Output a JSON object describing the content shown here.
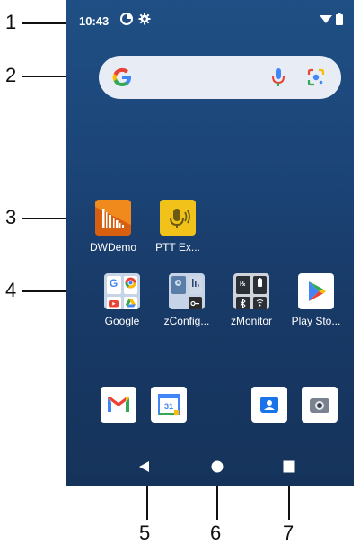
{
  "callouts": [
    "1",
    "2",
    "3",
    "4",
    "5",
    "6",
    "7"
  ],
  "status_bar": {
    "time": "10:43",
    "icons": [
      "data-saver-icon",
      "settings-gear-icon",
      "wifi-icon",
      "battery-icon"
    ]
  },
  "search": {
    "logo_icon": "google-g-icon",
    "mic_icon": "microphone-icon",
    "lens_icon": "google-lens-icon"
  },
  "apps": [
    {
      "label": "DWDemo",
      "icon": "dwdemo-icon",
      "color": "#f08a1c"
    },
    {
      "label": "PTT Ex...",
      "icon": "ptt-express-icon",
      "color": "#f0c21a"
    },
    {
      "label": "Google",
      "icon": "google-folder-icon"
    },
    {
      "label": "zConfig...",
      "icon": "zconfigure-folder-icon"
    },
    {
      "label": "zMonitor",
      "icon": "zmonitor-folder-icon"
    },
    {
      "label": "Play Sto...",
      "icon": "play-store-icon"
    }
  ],
  "dock": [
    {
      "icon": "gmail-icon"
    },
    {
      "icon": "calendar-icon",
      "day": "31"
    },
    {
      "icon": "contacts-icon"
    },
    {
      "icon": "camera-icon"
    }
  ],
  "nav": [
    "back-icon",
    "home-icon",
    "recents-icon"
  ],
  "colors": {
    "wallpaper_top": "#1f4f84",
    "wallpaper_bottom": "#15335a",
    "google_blue": "#4285f4",
    "google_red": "#ea4335",
    "google_yellow": "#fbbc05",
    "google_green": "#34a853"
  }
}
